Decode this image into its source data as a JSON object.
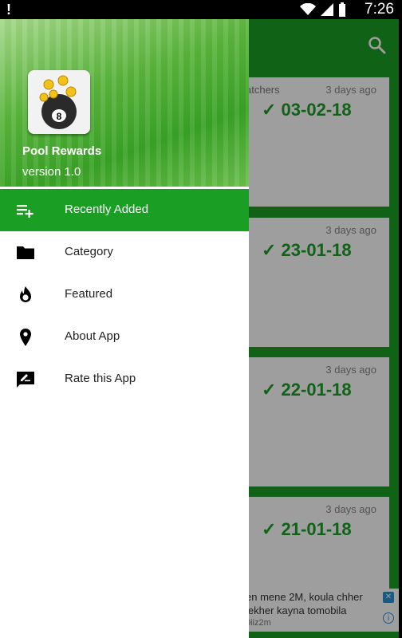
{
  "status_bar": {
    "time": "7:26",
    "warning_symbol": "!"
  },
  "drawer": {
    "app_name": "Pool Rewards",
    "version": "version 1.0",
    "items": [
      {
        "label": "Recently Added",
        "icon": "playlist-add-icon",
        "active": true
      },
      {
        "label": "Category",
        "icon": "folder-icon",
        "active": false
      },
      {
        "label": "Featured",
        "icon": "flame-icon",
        "active": false
      },
      {
        "label": "About App",
        "icon": "location-pin-icon",
        "active": false
      },
      {
        "label": "Rate this App",
        "icon": "rate-review-icon",
        "active": false
      }
    ]
  },
  "cards": [
    {
      "name_fragment": "atchers",
      "ago": "3 days ago",
      "date": "✓ 03-02-18"
    },
    {
      "ago": "3 days ago",
      "date": "✓ 23-01-18"
    },
    {
      "ago": "3 days ago",
      "date": "✓ 22-01-18"
    },
    {
      "ago": "3 days ago",
      "date": "✓ 21-01-18"
    }
  ],
  "ad": {
    "line1": "en mene 2M, koula chher",
    "line2": "lekher kayna tomobila",
    "line3": "0iiz2m"
  },
  "colors": {
    "primary": "#1b9e24",
    "background": "#c9c9c9"
  }
}
